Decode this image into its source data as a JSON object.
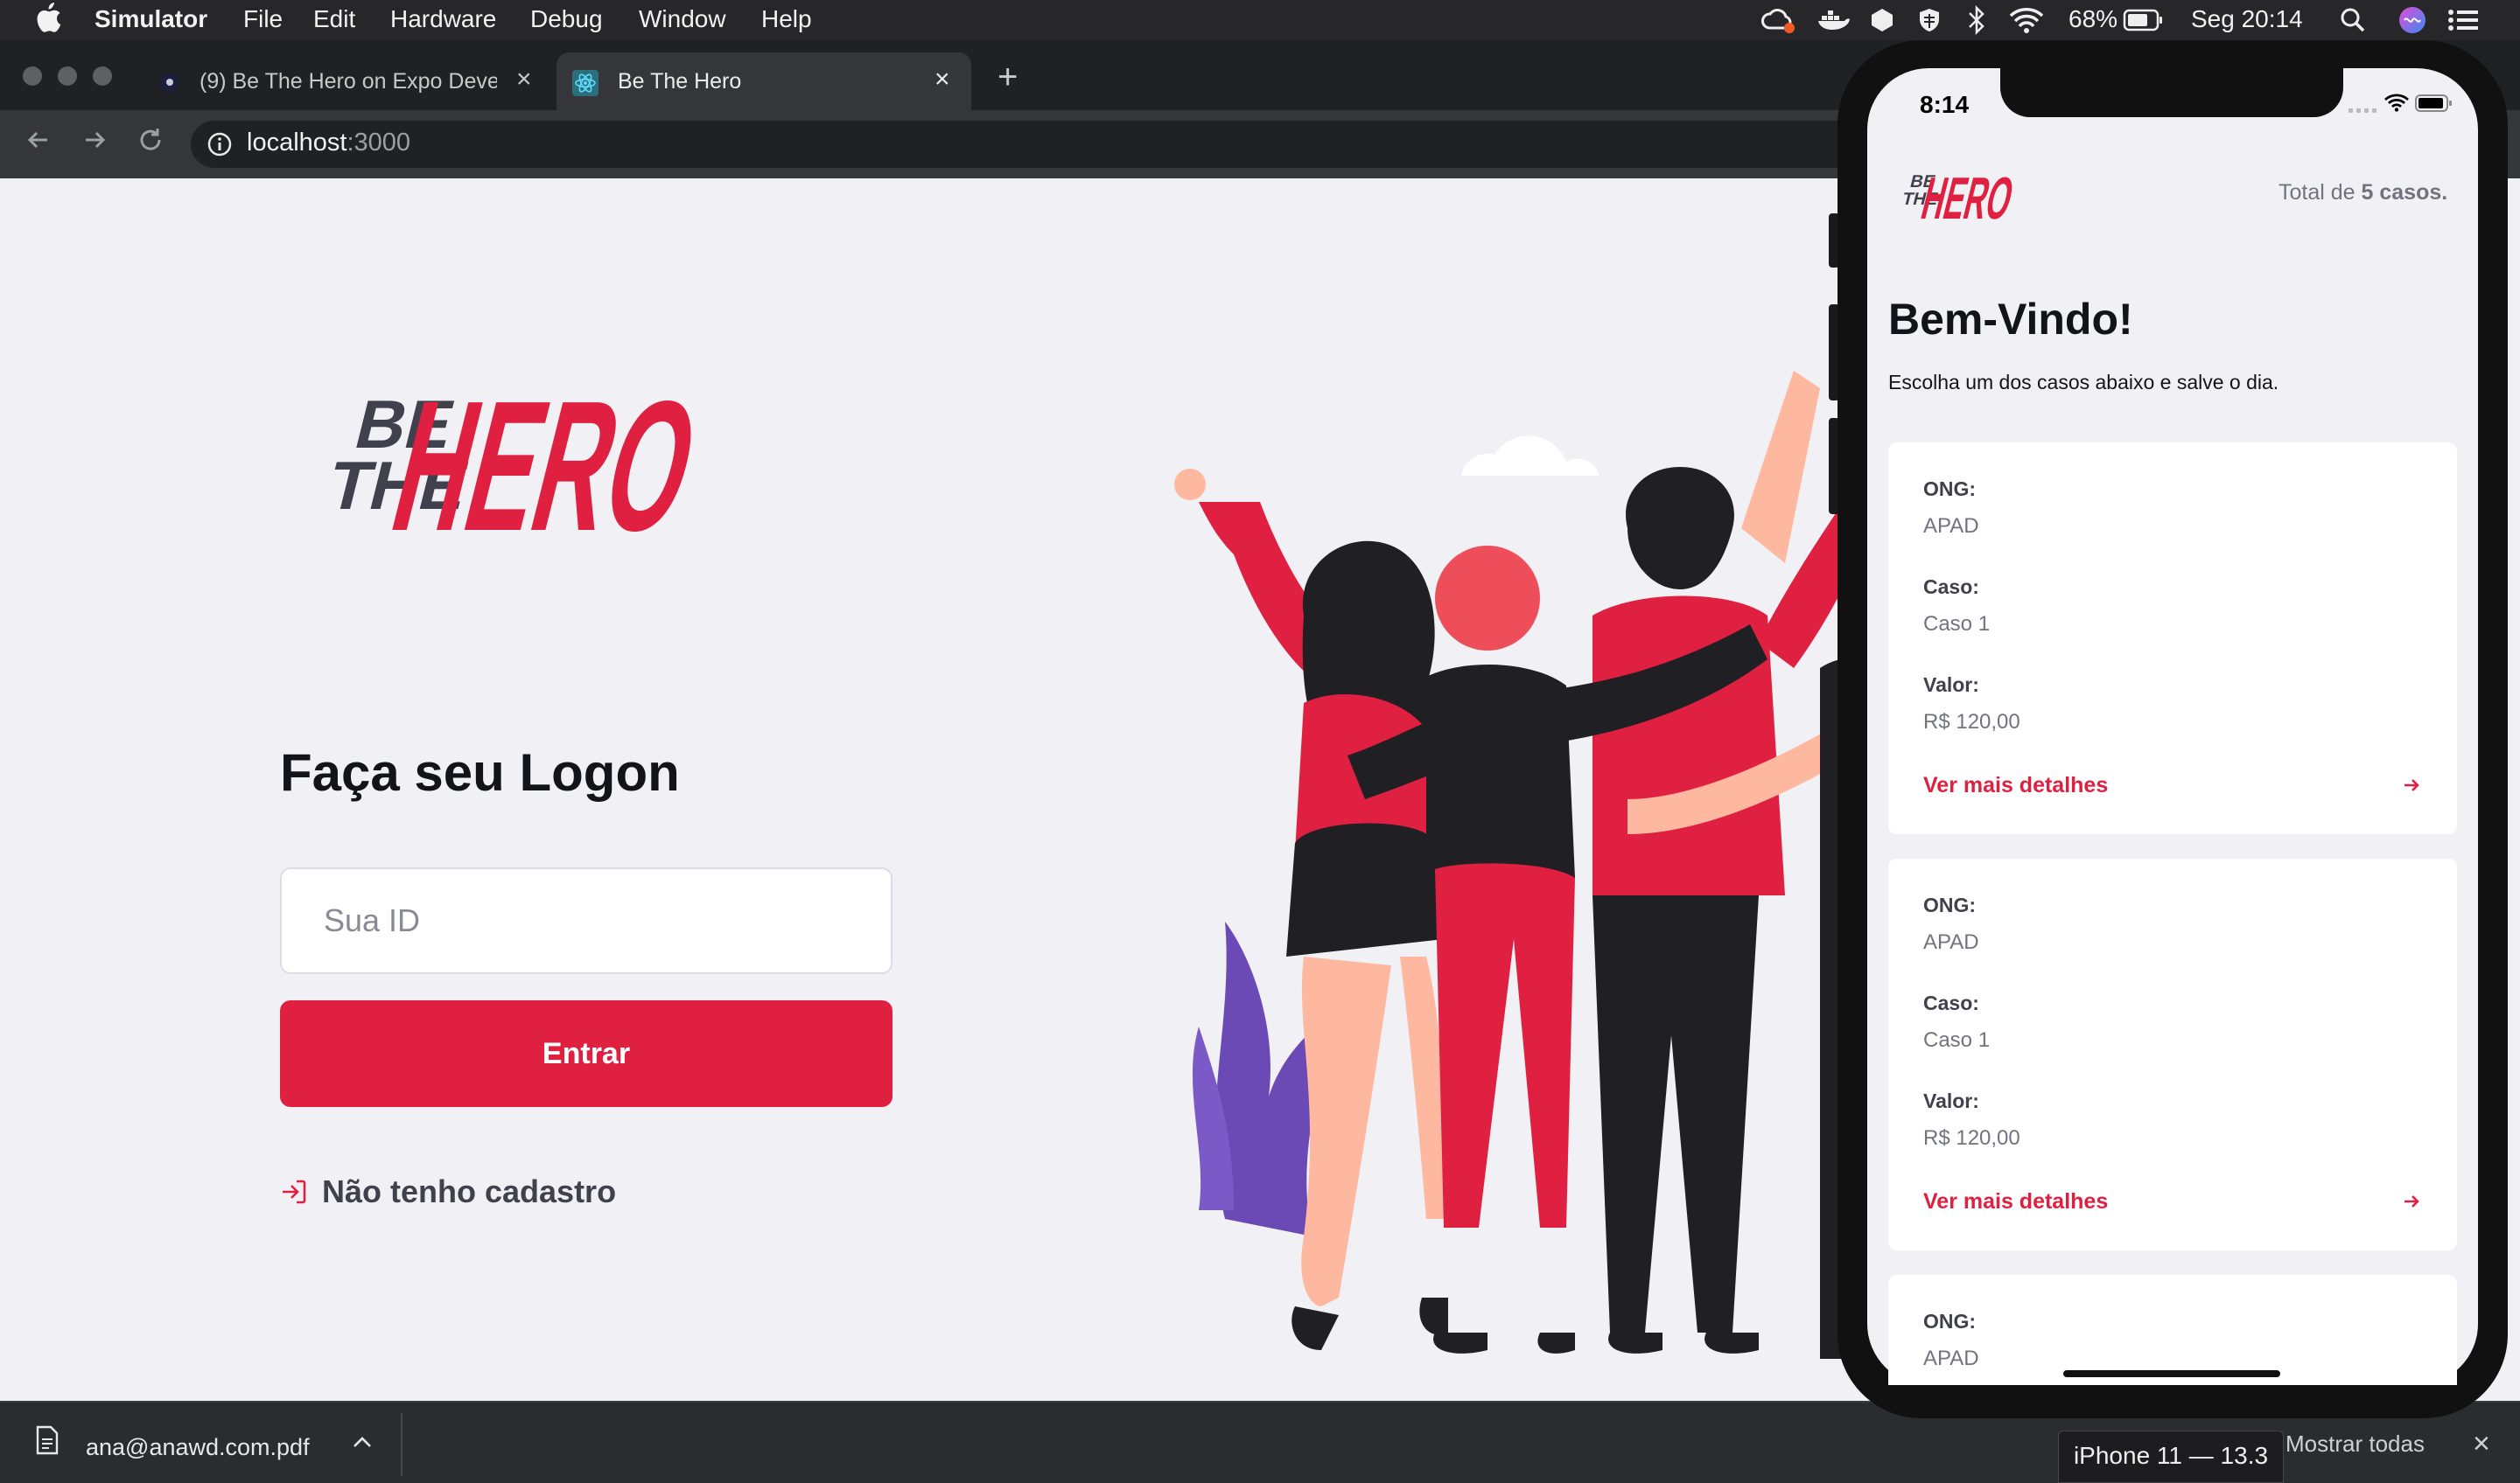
{
  "menubar": {
    "app": "Simulator",
    "items": [
      "File",
      "Edit",
      "Hardware",
      "Debug",
      "Window",
      "Help"
    ],
    "battery": "68%",
    "clock": "Seg 20:14"
  },
  "browser": {
    "tabs": [
      {
        "title": "(9) Be The Hero on Expo Devel"
      },
      {
        "title": "Be The Hero"
      }
    ],
    "url_host": "localhost",
    "url_port": ":3000"
  },
  "login": {
    "logo_text": {
      "be": "BE",
      "the": "THE",
      "hero": "HERO"
    },
    "heading": "Faça seu Logon",
    "id_placeholder": "Sua ID",
    "enter_label": "Entrar",
    "register_link": "Não tenho cadastro"
  },
  "downloads": {
    "file": "ana@anawd.com.pdf",
    "show_all": "Mostrar todas"
  },
  "simulator": {
    "device_label": "iPhone 11 — 13.3"
  },
  "mobile": {
    "status_time": "8:14",
    "total_prefix": "Total de ",
    "total_count": "5 casos.",
    "title": "Bem-Vindo!",
    "description": "Escolha um dos casos abaixo e salve o dia.",
    "incidents": [
      {
        "ong_label": "ONG:",
        "ong": "APAD",
        "case_label": "Caso:",
        "case": "Caso 1",
        "value_label": "Valor:",
        "value": "R$ 120,00",
        "details": "Ver mais detalhes"
      },
      {
        "ong_label": "ONG:",
        "ong": "APAD",
        "case_label": "Caso:",
        "case": "Caso 1",
        "value_label": "Valor:",
        "value": "R$ 120,00",
        "details": "Ver mais detalhes"
      },
      {
        "ong_label": "ONG:",
        "ong": "APAD"
      }
    ]
  },
  "colors": {
    "brand_red": "#e02041",
    "page_bg": "#f0f0f5",
    "text_dark": "#13131a"
  }
}
